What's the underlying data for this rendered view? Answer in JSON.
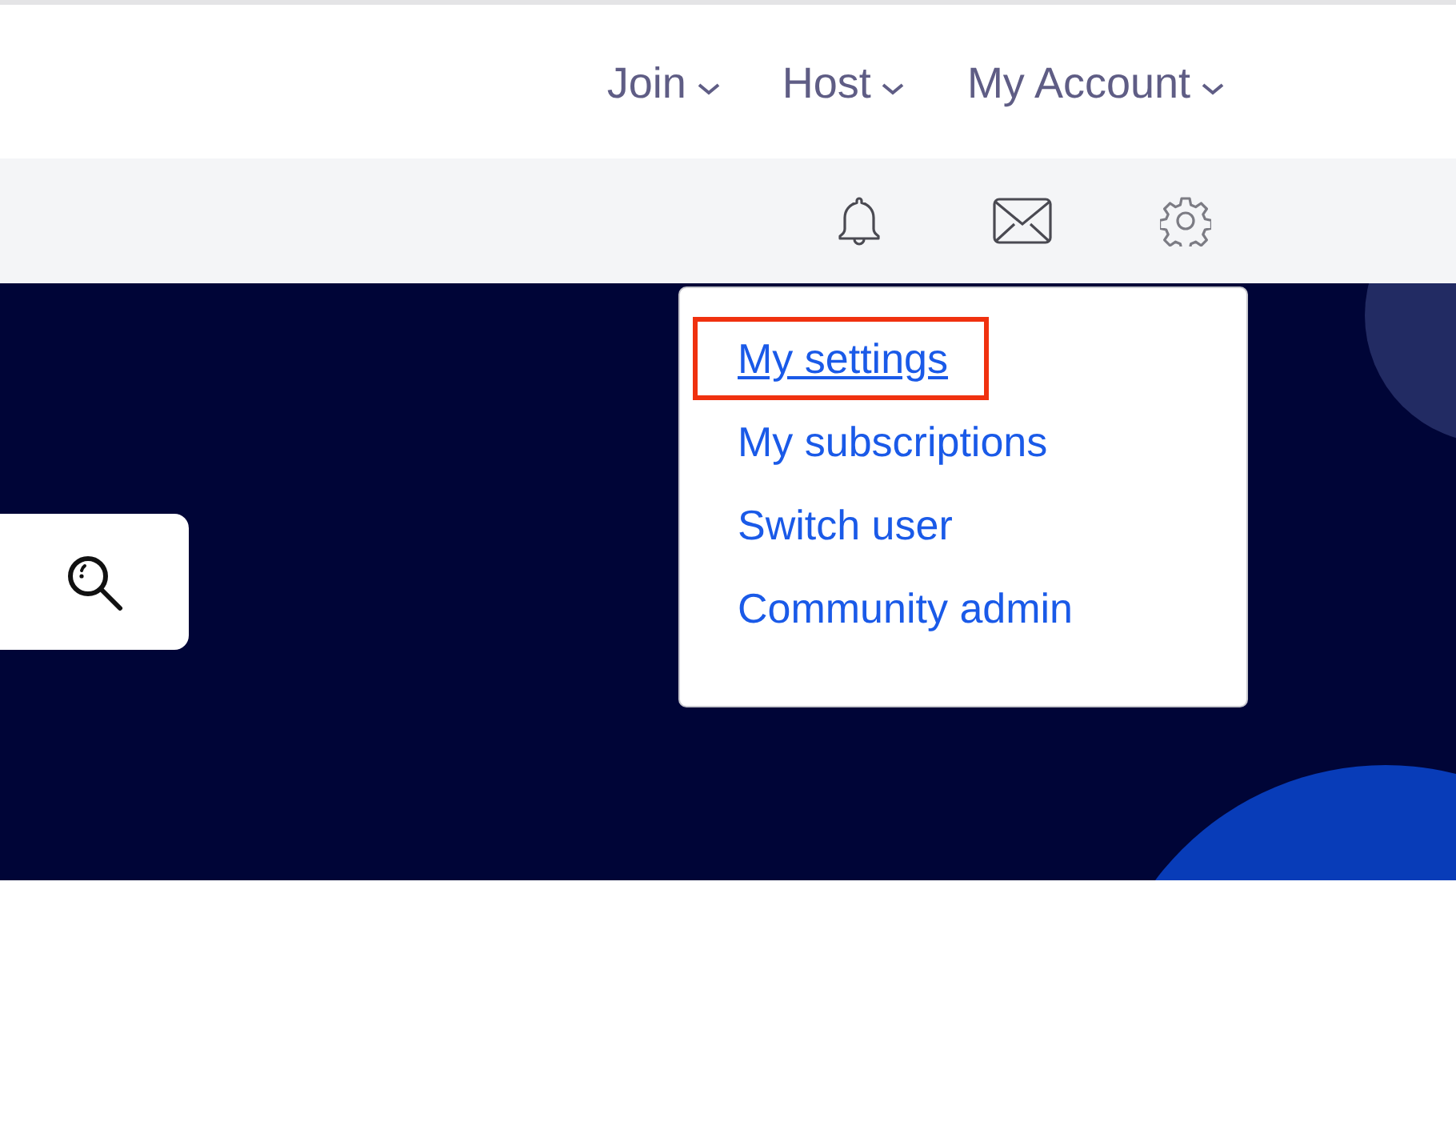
{
  "nav": {
    "items": [
      {
        "label": "Join",
        "has_menu": true
      },
      {
        "label": "Host",
        "has_menu": true
      },
      {
        "label": "My Account",
        "has_menu": true
      }
    ]
  },
  "account_menu": {
    "open": true,
    "items": [
      {
        "label": "My settings",
        "highlighted": true
      },
      {
        "label": "My subscriptions",
        "highlighted": false
      },
      {
        "label": "Switch user",
        "highlighted": false
      },
      {
        "label": "Community admin",
        "highlighted": false
      }
    ]
  }
}
